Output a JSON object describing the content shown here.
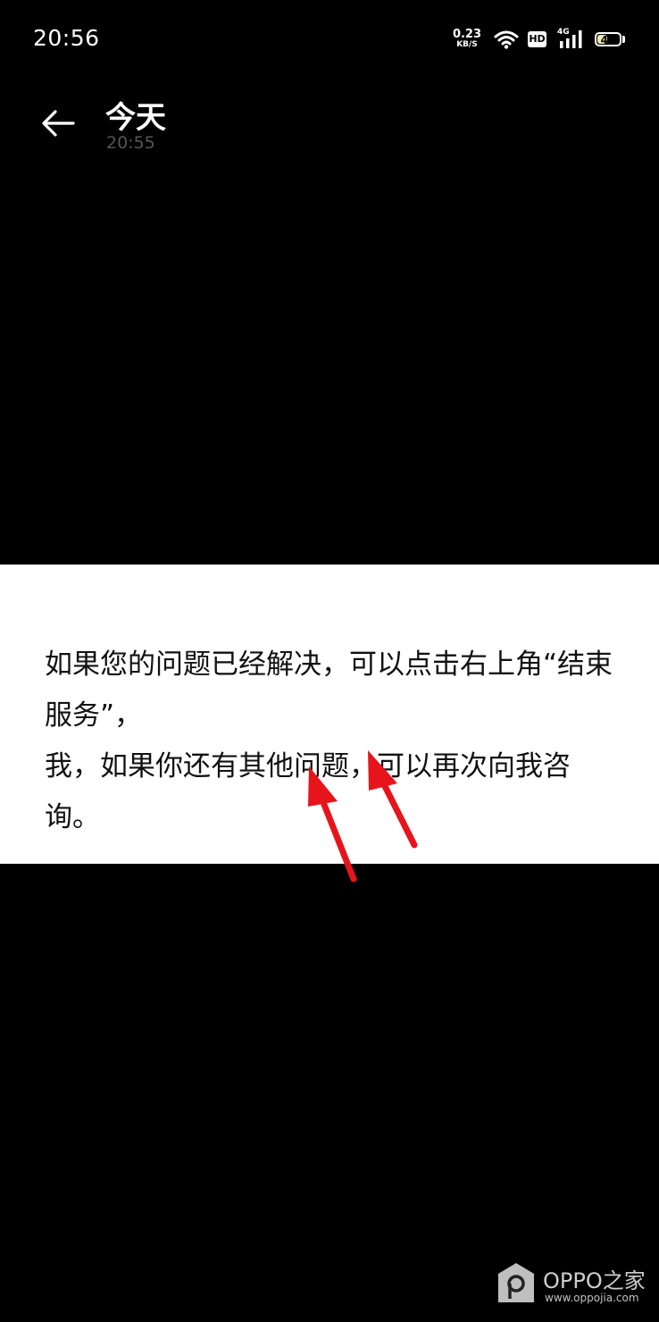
{
  "status_bar": {
    "time": "20:56",
    "net_speed_value": "0.23",
    "net_speed_unit": "KB/S",
    "hd_label": "HD",
    "network_type": "4G",
    "battery_level": "42",
    "battery_fraction": 0.42,
    "icons": [
      "wifi-icon",
      "signal-icon"
    ]
  },
  "header": {
    "back_icon": "arrow-left-icon",
    "title": "今天",
    "subtitle": "20:55"
  },
  "content": {
    "line1": "如果您的问题已经解决，可以点击右上角“结束服务”，",
    "line2": "我，如果你还有其他问题，可以再次向我咨询。",
    "arrow_color": "#e8141c"
  },
  "watermark": {
    "brand": "OPPO之家",
    "url": "www.oppojia.com"
  }
}
